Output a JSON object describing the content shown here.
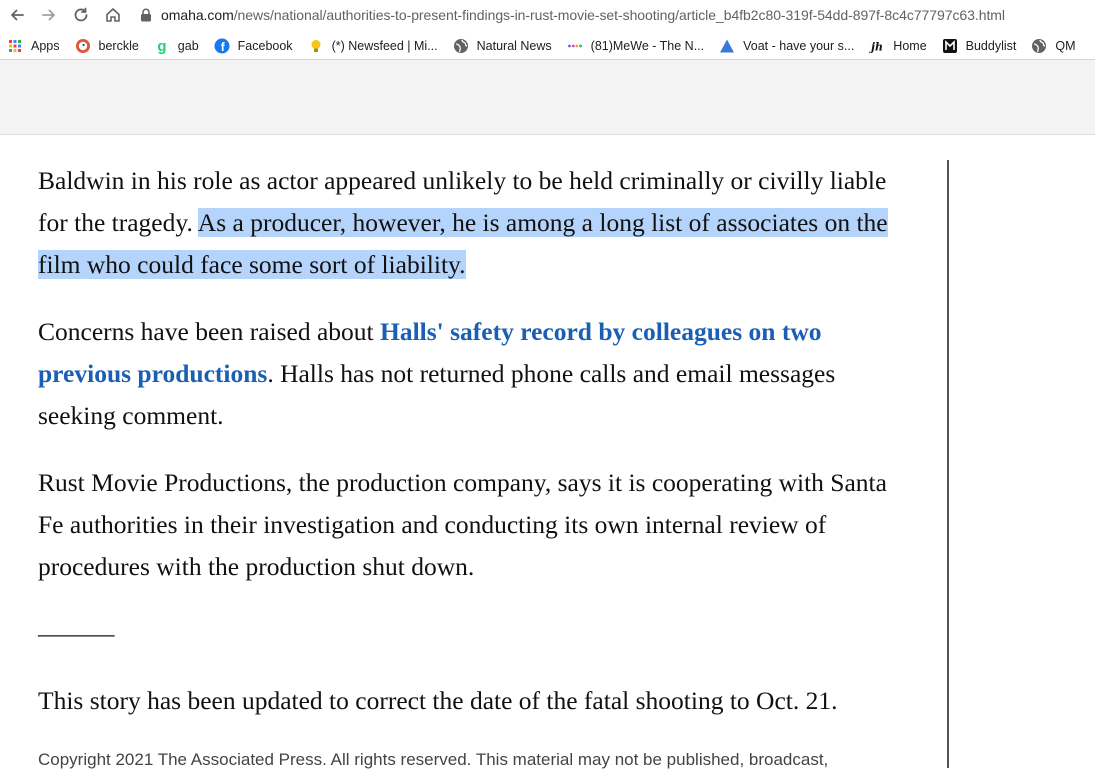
{
  "browser": {
    "url_host": "omaha.com",
    "url_path": "/news/national/authorities-to-present-findings-in-rust-movie-set-shooting/article_b4fb2c80-319f-54dd-897f-8c4c77797c63.html",
    "bookmarks": [
      {
        "label": "Apps",
        "icon": "apps-grid-icon"
      },
      {
        "label": "berckle",
        "icon": "duckduckgo-icon"
      },
      {
        "label": "gab",
        "icon": "gab-icon"
      },
      {
        "label": "Facebook",
        "icon": "facebook-icon"
      },
      {
        "label": "(*) Newsfeed | Mi...",
        "icon": "lightbulb-icon"
      },
      {
        "label": "Natural News",
        "icon": "globe-icon"
      },
      {
        "label": "(81)MeWe - The N...",
        "icon": "mewe-icon"
      },
      {
        "label": "Voat - have your s...",
        "icon": "voat-icon"
      },
      {
        "label": "Home",
        "icon": "jh-icon"
      },
      {
        "label": "Buddylist",
        "icon": "buddylist-icon"
      },
      {
        "label": "QM",
        "icon": "globe-icon"
      }
    ]
  },
  "article": {
    "p1_plain": "Baldwin in his role as actor appeared unlikely to be held criminally or civilly liable for the tragedy. ",
    "p1_selected": "As a producer, however, he is among a long list of associates on the film who could face some sort of liability.",
    "p2_before": "Concerns have been raised about ",
    "p2_link": "Halls' safety record by colleagues on two previous productions",
    "p2_after": ". Halls has not returned phone calls and email messages seeking comment.",
    "p3": "Rust Movie Productions, the production company, says it is cooperating with Santa Fe authorities in their investigation and conducting its own internal review of procedures with the production shut down.",
    "separator": "———",
    "p4": "This story has been updated to correct the date of the fatal shooting to Oct. 21.",
    "copyright": "Copyright 2021 The Associated Press. All rights reserved. This material may not be published, broadcast,"
  },
  "colors": {
    "selection": "#b4d4fc",
    "link": "#1a5fb4"
  }
}
